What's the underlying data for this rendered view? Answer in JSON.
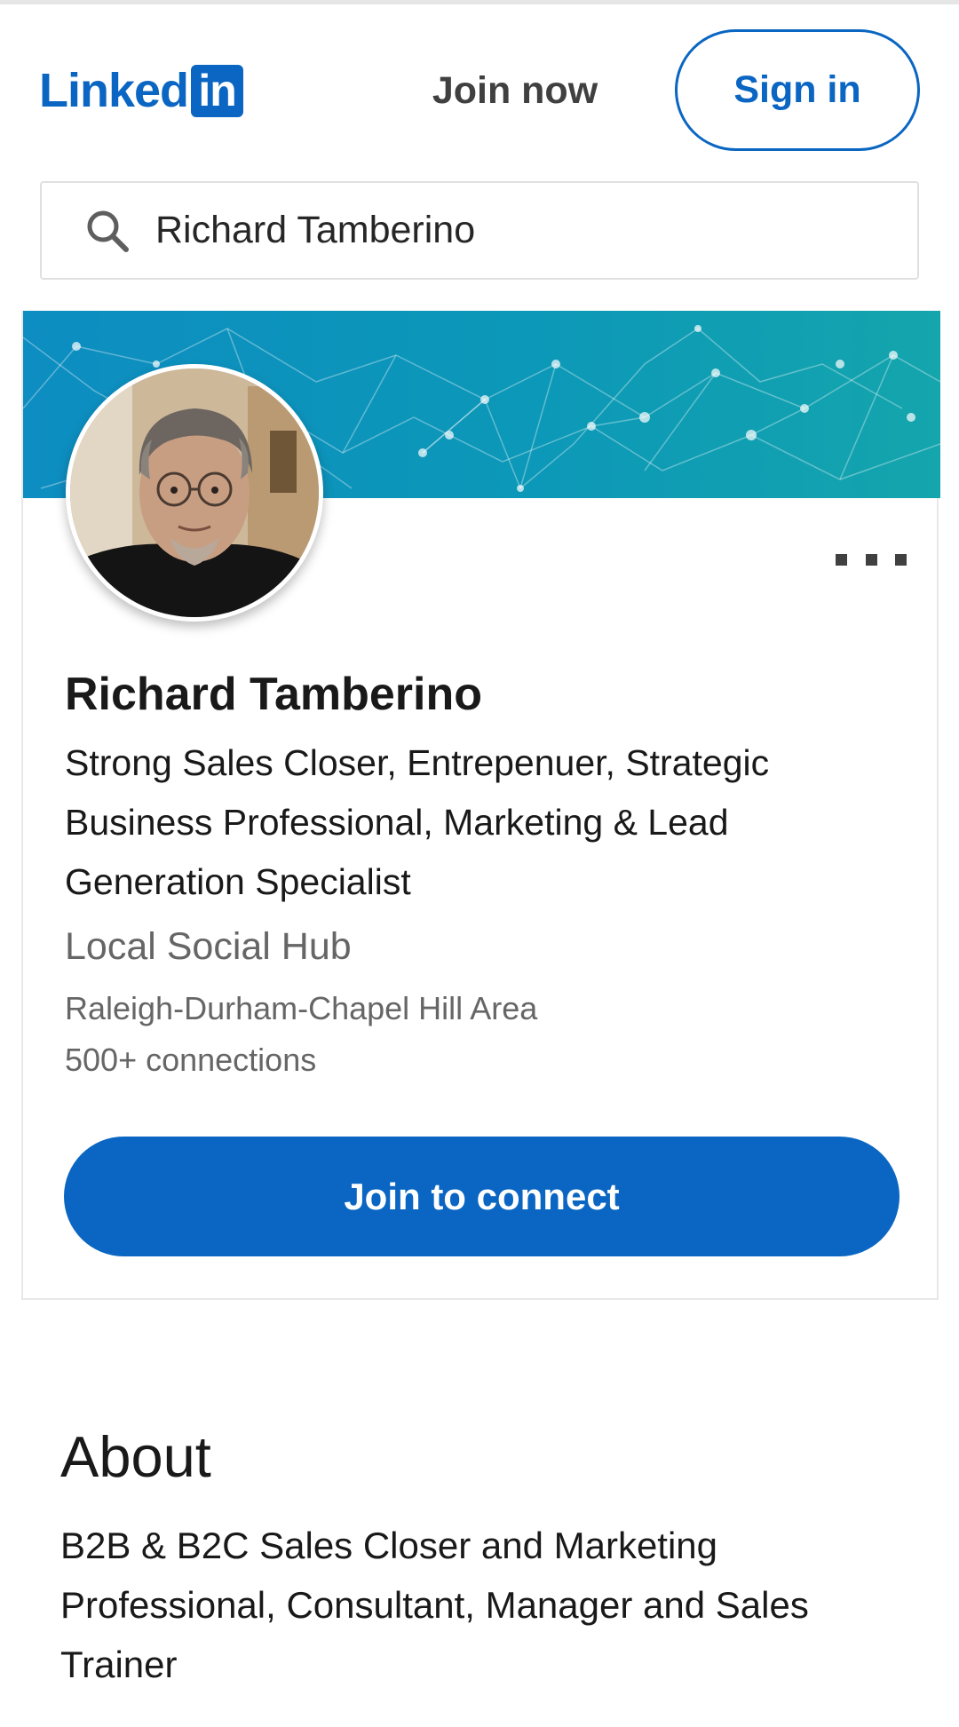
{
  "header": {
    "logo_text": "Linked",
    "logo_box_text": "in",
    "join_now_label": "Join now",
    "sign_in_label": "Sign in"
  },
  "search": {
    "value": "Richard Tamberino",
    "icon": "search-icon"
  },
  "profile": {
    "name": "Richard Tamberino",
    "headline": "Strong Sales Closer, Entrepenuer, Strategic Business Professional, Marketing & Lead Generation Specialist",
    "company": "Local Social Hub",
    "location": "Raleigh-Durham-Chapel Hill Area",
    "connections": "500+ connections",
    "join_button_label": "Join to connect",
    "more_icon": "more-options-icon"
  },
  "about": {
    "title": "About",
    "text": "B2B & B2C Sales Closer and Marketing Professional, Consultant, Manager and Sales Trainer"
  },
  "colors": {
    "brand": "#0a66c2",
    "banner_start": "#0d8dc1",
    "banner_end": "#14a5ad",
    "secondary_text": "#666666",
    "primary_text": "#191919"
  }
}
